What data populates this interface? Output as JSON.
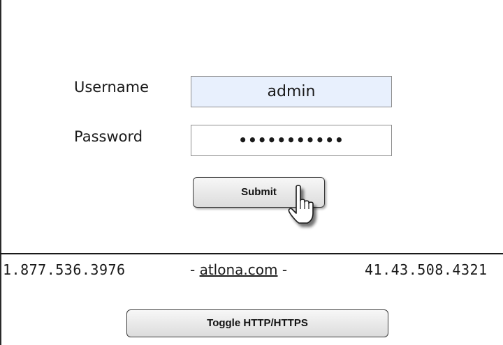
{
  "login_form": {
    "username_label": "Username",
    "password_label": "Password",
    "username_value": "admin",
    "password_value": "•••••••••••",
    "submit_label": "Submit"
  },
  "footer": {
    "phone_left": "1.877.536.3976",
    "site_prefix": "- ",
    "site_link": "atlona.com",
    "site_suffix": " -",
    "phone_right": "41.43.508.4321",
    "toggle_label": "Toggle HTTP/HTTPS"
  },
  "cursor": {
    "icon": "hand-pointer-icon"
  }
}
